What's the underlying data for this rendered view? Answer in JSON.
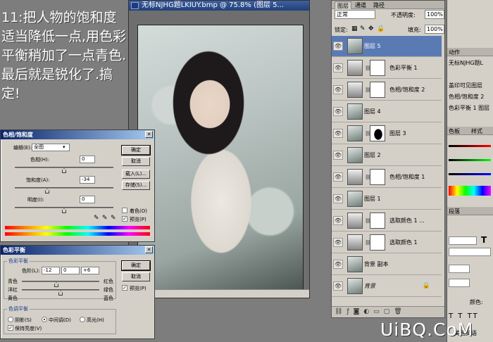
{
  "caption": "11:把人物的饱和度适当降低一点,用色彩平衡稍加了一点青色.最后就是锐化了.搞定!",
  "document": {
    "title": "无标NJHG题LKIUY.bmp @ 75.8% (图层 5..."
  },
  "hue_sat_dialog": {
    "title": "色相/饱和度",
    "edit_label": "编辑(E):",
    "edit_value": "全图",
    "hue_label": "色相(H):",
    "hue_value": "0",
    "sat_label": "饱和度(A):",
    "sat_value": "-34",
    "light_label": "明度(I):",
    "light_value": "0",
    "ok": "确定",
    "cancel": "取消",
    "load": "载入(L)...",
    "save": "存储(S)...",
    "colorize": "着色(O)",
    "preview": "预览(P)"
  },
  "color_balance_dialog": {
    "title": "色彩平衡",
    "group_balance": "色彩平衡",
    "levels_label": "色阶(L):",
    "levels": [
      "-12",
      "0",
      "+6"
    ],
    "cyan": "青色",
    "red": "红色",
    "magenta": "洋红",
    "green": "绿色",
    "yellow": "黄色",
    "blue": "蓝色",
    "group_tone": "色调平衡",
    "shadows": "阴影(S)",
    "midtones": "中间调(D)",
    "highlights": "高光(H)",
    "preserve": "保持亮度(V)",
    "ok": "确定",
    "cancel": "取消",
    "preview": "预览(P)"
  },
  "layers_panel": {
    "tabs": [
      "图层",
      "通道",
      "路径"
    ],
    "blend_mode": "正常",
    "opacity_label": "不透明度:",
    "opacity": "100%",
    "lock_label": "锁定:",
    "fill_label": "填充:",
    "fill": "100%",
    "layers": [
      {
        "name": "图层 5",
        "kind": "photo",
        "selected": true
      },
      {
        "name": "色彩平衡 1",
        "kind": "adjustment"
      },
      {
        "name": "色相/饱和度 2",
        "kind": "adjustment"
      },
      {
        "name": "图层 4",
        "kind": "photo"
      },
      {
        "name": "图层 3",
        "kind": "masked"
      },
      {
        "name": "图层 2",
        "kind": "photo"
      },
      {
        "name": "色相/饱和度 1",
        "kind": "adjustment"
      },
      {
        "name": "图层 1",
        "kind": "photo"
      },
      {
        "name": "选取颜色 1 ...",
        "kind": "adjustment"
      },
      {
        "name": "选取颜色 1",
        "kind": "adjustment"
      },
      {
        "name": "背景 副本",
        "kind": "photo"
      },
      {
        "name": "背景",
        "kind": "photo",
        "locked": true
      }
    ]
  },
  "right_strip": {
    "tab_actions": "动作",
    "history_doc": "无标NJHG题L",
    "history_1": "盖印可见图层",
    "history_2": "色相/饱和度 2",
    "history_3": "色彩平衡 1 图层",
    "tab_color": "色板",
    "tab_styles": "样式",
    "tab_paragraph": "段落",
    "color_label": "颜色:",
    "lang": "美国英语"
  },
  "watermark": "UiBQ.CoM"
}
